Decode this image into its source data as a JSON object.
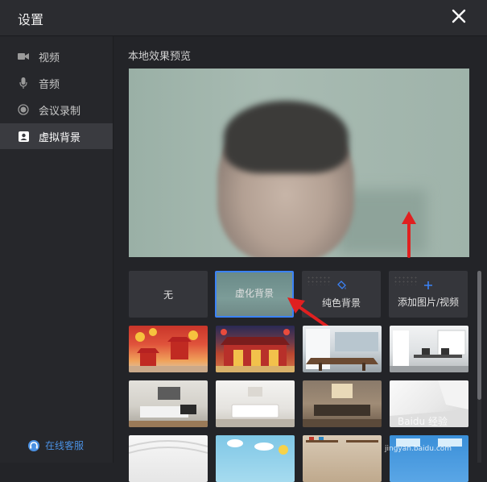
{
  "window": {
    "title": "设置"
  },
  "sidebar": {
    "items": [
      {
        "label": "视频",
        "icon": "video-camera-icon",
        "active": false
      },
      {
        "label": "音频",
        "icon": "microphone-icon",
        "active": false
      },
      {
        "label": "会议录制",
        "icon": "record-icon",
        "active": false
      },
      {
        "label": "虚拟背景",
        "icon": "portrait-icon",
        "active": true
      }
    ],
    "support_label": "在线客服"
  },
  "main": {
    "preview_title": "本地效果预览",
    "options": [
      {
        "label": "无",
        "selected": false
      },
      {
        "label": "虚化背景",
        "selected": true
      },
      {
        "label": "纯色背景",
        "selected": false,
        "icon": "paint-bucket-icon"
      },
      {
        "label": "添加图片/视频",
        "selected": false,
        "icon": "plus-icon"
      }
    ],
    "thumbnails": [
      {
        "name": "chinese-new-year-1"
      },
      {
        "name": "chinese-new-year-2"
      },
      {
        "name": "dining-room"
      },
      {
        "name": "office"
      },
      {
        "name": "living-room-gray"
      },
      {
        "name": "living-room-white"
      },
      {
        "name": "living-room-dark"
      },
      {
        "name": "empty-white-room"
      },
      {
        "name": "white-ceiling"
      },
      {
        "name": "cartoon-sky"
      },
      {
        "name": "shelves-room"
      },
      {
        "name": "blue-room"
      }
    ]
  },
  "watermark": {
    "text": "Baidu 经验",
    "url_text": "jingyan.baidu.com"
  },
  "colors": {
    "accent": "#3b82f6",
    "arrow": "#e02020",
    "support": "#4a90e2"
  }
}
